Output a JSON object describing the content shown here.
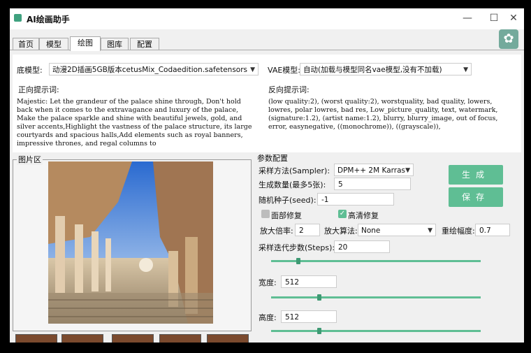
{
  "window": {
    "title": "AI绘画助手"
  },
  "tabs": [
    "首页",
    "模型",
    "绘图",
    "图库",
    "配置"
  ],
  "top": {
    "base_model_label": "底模型:",
    "base_model_value": "动漫2D插画5GB版本cetusMix_Codaedition.safetensors",
    "vae_label": "VAE模型:",
    "vae_value": "自动(加载与模型同名vae模型,没有不加载)",
    "positive_label": "正向提示词:",
    "positive_text": "Majestic: Let the grandeur of the palace shine through, Don't hold back when it comes to the extravagance and luxury of the palace, Make the palace sparkle and shine with beautiful jewels, gold, and silver accents,Highlight the vastness of the palace structure, its large courtyards and spacious halls,Add elements such as royal banners, impressive thrones, and regal columns to",
    "negative_label": "反向提示词:",
    "negative_text": "(low quality:2), (worst quality:2), worstquality, bad quality, lowers, lowres, polar lowres, bad res, Low_picture_quality, text, watermark, (signature:1.2), (artist name:1.2), blurry, blurry_image, out of focus, error, easynegative, ((monochrome)), ((grayscale)),"
  },
  "image_area": {
    "label": "图片区"
  },
  "params": {
    "group_label": "参数配置",
    "sampler_label": "采样方法(Sampler):",
    "sampler_value": "DPM++ 2M Karras",
    "count_label": "生成数量(最多5张):",
    "count_value": "5",
    "seed_label": "随机种子(seed):",
    "seed_value": "-1",
    "face_fix_label": "面部修复",
    "hires_label": "高清修复",
    "face_fix_checked": false,
    "hires_checked": true,
    "upscale_label": "放大倍率:",
    "upscale_value": "2",
    "upscaler_label": "放大算法:",
    "upscaler_value": "None",
    "redraw_label": "重绘幅度:",
    "redraw_value": "0.7",
    "steps_label": "采样迭代步数(Steps):",
    "steps_value": "20",
    "steps_fraction": 0.13,
    "width_label": "宽度:",
    "width_value": "512",
    "width_fraction": 0.23,
    "height_label": "高度:",
    "height_value": "512",
    "height_fraction": 0.23,
    "generate_label": "生成",
    "save_label": "保存"
  },
  "colors": {
    "accent": "#5fbe94"
  }
}
